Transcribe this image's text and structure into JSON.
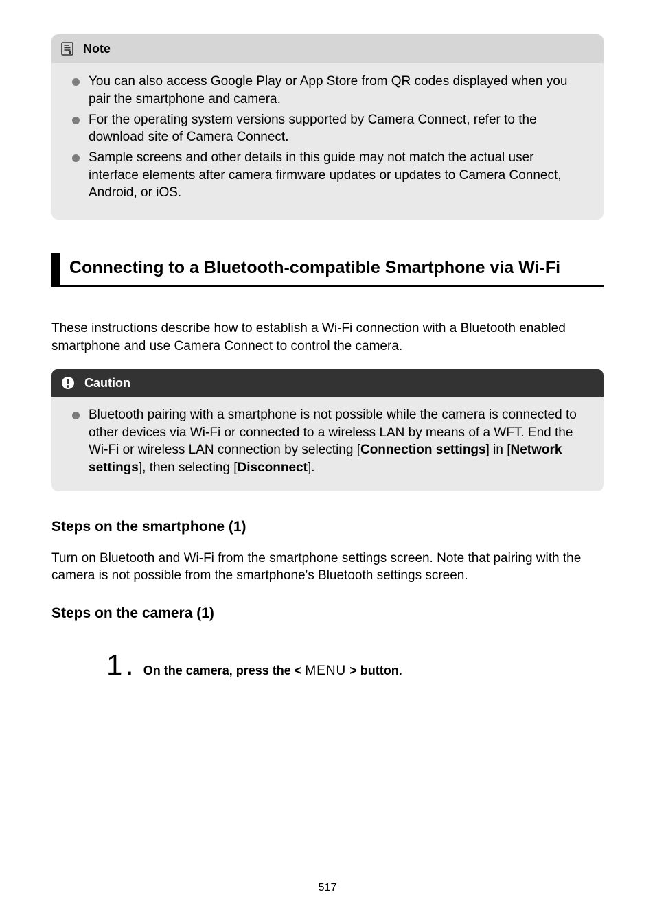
{
  "note": {
    "title": "Note",
    "items": [
      "You can also access Google Play or App Store from QR codes displayed when you pair the smartphone and camera.",
      "For the operating system versions supported by Camera Connect, refer to the download site of Camera Connect.",
      "Sample screens and other details in this guide may not match the actual user interface elements after camera firmware updates or updates to Camera Connect, Android, or iOS."
    ]
  },
  "section": {
    "heading": "Connecting to a Bluetooth-compatible Smartphone via Wi-Fi",
    "intro": "These instructions describe how to establish a Wi-Fi connection with a Bluetooth enabled smartphone and use Camera Connect to control the camera."
  },
  "caution": {
    "title": "Caution",
    "item_pre": "Bluetooth pairing with a smartphone is not possible while the camera is connected to other devices via Wi-Fi or connected to a wireless LAN by means of a WFT. End the Wi-Fi or wireless LAN connection by selecting [",
    "item_bold1": "Connection settings",
    "item_mid": "] in [",
    "item_bold2": "Network settings",
    "item_mid2": "], then selecting [",
    "item_bold3": "Disconnect",
    "item_post": "]."
  },
  "steps_phone": {
    "heading": "Steps on the smartphone (1)",
    "text": "Turn on Bluetooth and Wi-Fi from the smartphone settings screen. Note that pairing with the camera is not possible from the smartphone's Bluetooth settings screen."
  },
  "steps_camera": {
    "heading": "Steps on the camera (1)",
    "step_num": "1",
    "step_pre": "On the camera, press the < ",
    "step_glyph": "MENU",
    "step_post": " > button."
  },
  "page": "517"
}
